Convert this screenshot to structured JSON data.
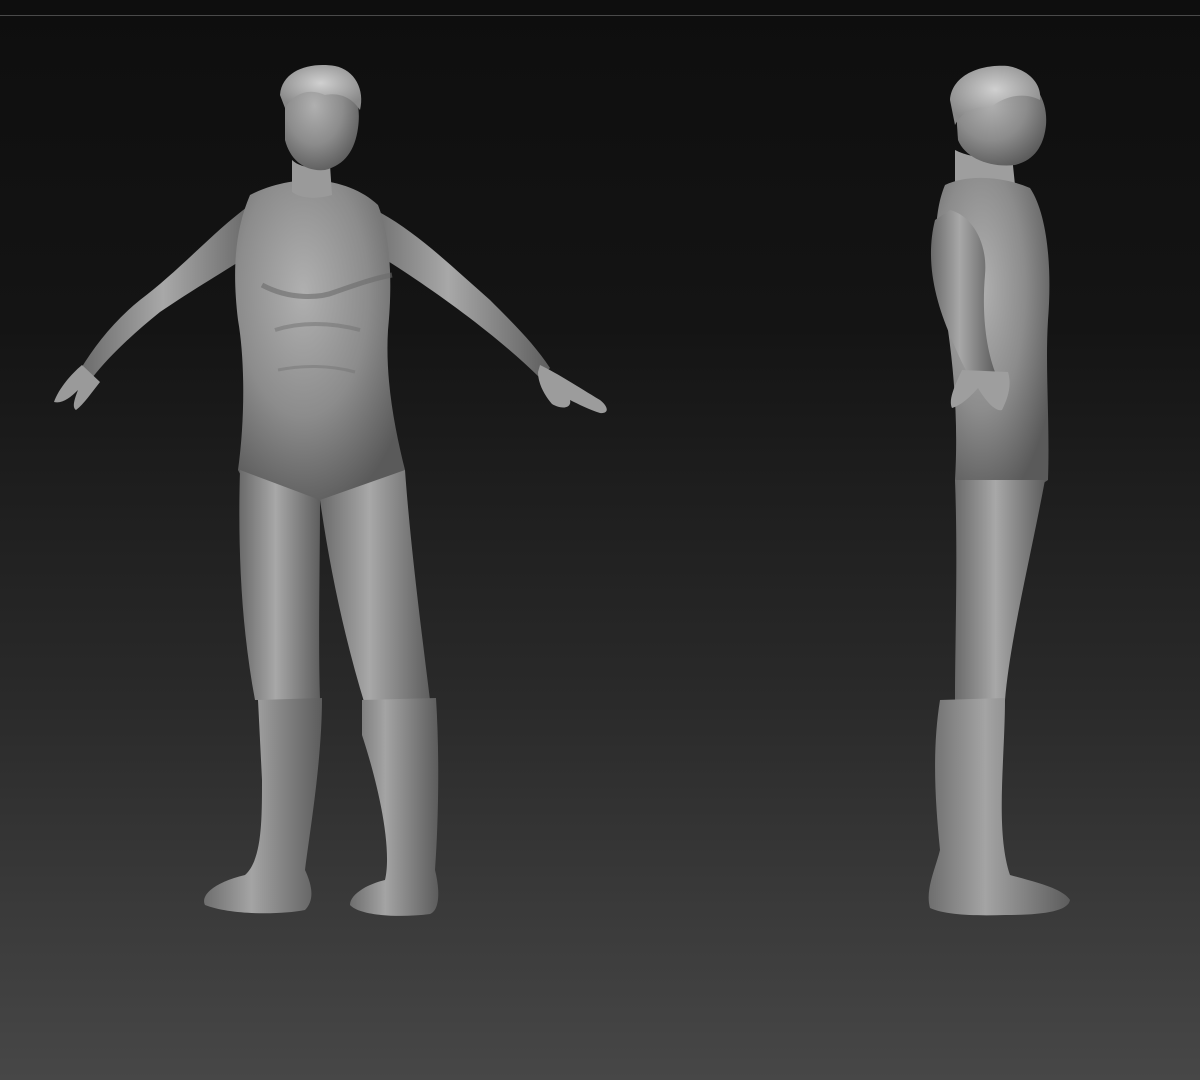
{
  "viewport": {
    "background_top": "#0e0e0e",
    "background_bottom": "#474747",
    "model_color": "#8a8a8a",
    "model_highlight": "#b8b8b8",
    "model_shadow": "#4a4a4a"
  },
  "views": [
    {
      "name": "three-quarter-front-view"
    },
    {
      "name": "side-profile-view"
    }
  ]
}
